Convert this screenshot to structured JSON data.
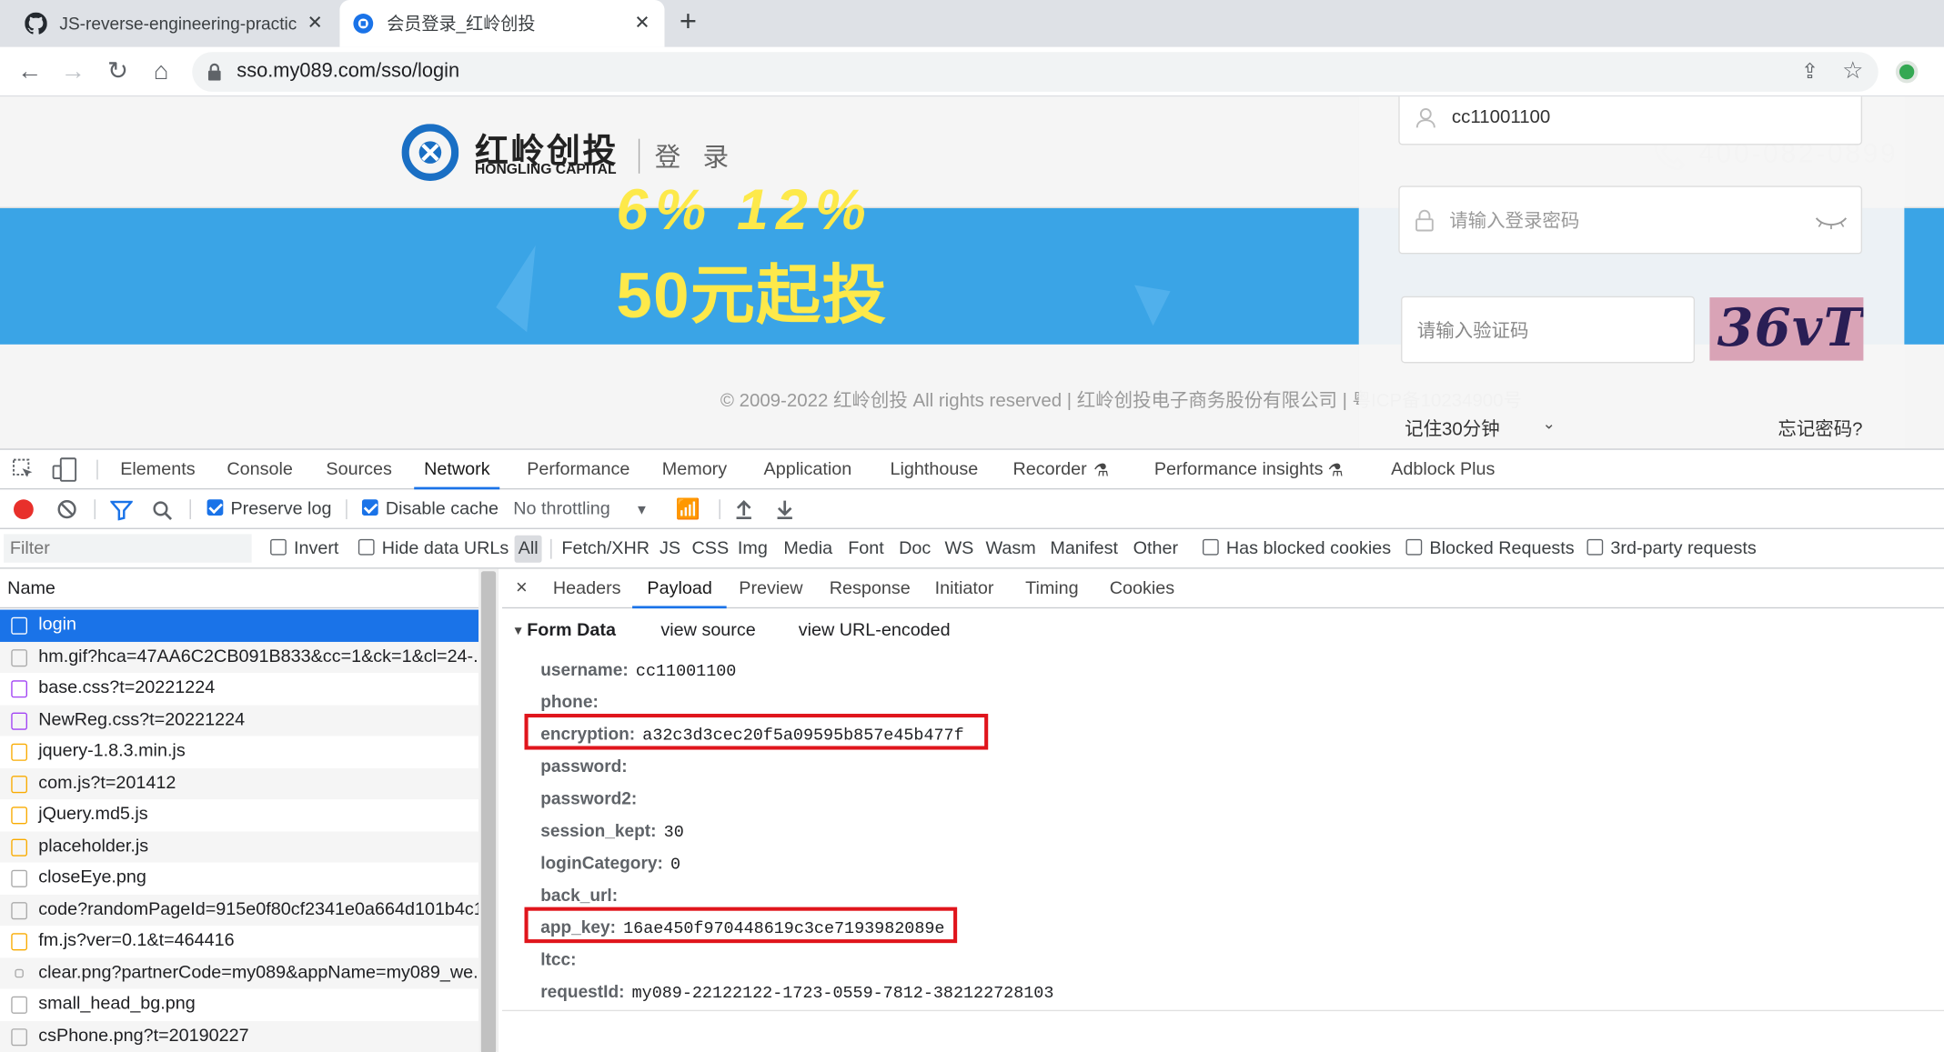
{
  "browser": {
    "tabs": [
      {
        "title": "JS-reverse-engineering-practic",
        "icon": "github-icon",
        "close": "✕"
      },
      {
        "title": "会员登录_红岭创投",
        "icon": "site-favicon-icon",
        "close": "✕"
      }
    ],
    "new_tab": "+",
    "url": "sso.my089.com/sso/login"
  },
  "page": {
    "logo_cn": "红岭创投",
    "logo_en": "HONGLING CAPITAL",
    "page_label": "登 录",
    "banner_top": "6% 12%",
    "banner_text": "50元起投",
    "hotline": "400-082-0899",
    "footer": "© 2009-2022 红岭创投 All rights reserved  |  红岭创投电子商务股份有限公司  |  粤ICP备10234900号",
    "login": {
      "username_value": "cc11001100",
      "password_placeholder": "请输入登录密码",
      "captcha_placeholder": "请输入验证码",
      "captcha_image_text": "36vT",
      "remember": "记住30分钟",
      "forgot": "忘记密码?"
    }
  },
  "devtools": {
    "tabs": [
      "Elements",
      "Console",
      "Sources",
      "Network",
      "Performance",
      "Memory",
      "Application",
      "Lighthouse",
      "Recorder",
      "Performance insights",
      "Adblock Plus"
    ],
    "active_tab": "Network",
    "toolbar": {
      "preserve_log": "Preserve log",
      "disable_cache": "Disable cache",
      "throttling": "No throttling"
    },
    "filter": {
      "placeholder": "Filter",
      "invert": "Invert",
      "hide_data_urls": "Hide data URLs",
      "types": [
        "All",
        "Fetch/XHR",
        "JS",
        "CSS",
        "Img",
        "Media",
        "Font",
        "Doc",
        "WS",
        "Wasm",
        "Manifest",
        "Other"
      ],
      "has_blocked_cookies": "Has blocked cookies",
      "blocked_requests": "Blocked Requests",
      "third_party": "3rd-party requests"
    },
    "list_header": "Name",
    "requests": [
      {
        "name": "login",
        "type": "doc"
      },
      {
        "name": "hm.gif?hca=47AA6C2CB091B833&cc=1&ck=1&cl=24-...",
        "type": "img"
      },
      {
        "name": "base.css?t=20221224",
        "type": "css"
      },
      {
        "name": "NewReg.css?t=20221224",
        "type": "css"
      },
      {
        "name": "jquery-1.8.3.min.js",
        "type": "js"
      },
      {
        "name": "com.js?t=201412",
        "type": "js"
      },
      {
        "name": "jQuery.md5.js",
        "type": "js"
      },
      {
        "name": "placeholder.js",
        "type": "js"
      },
      {
        "name": "closeEye.png",
        "type": "img"
      },
      {
        "name": "code?randomPageId=915e0f80cf2341e0a664d101b4c1",
        "type": "img"
      },
      {
        "name": "fm.js?ver=0.1&t=464416",
        "type": "js"
      },
      {
        "name": "clear.png?partnerCode=my089&appName=my089_we...",
        "type": "img"
      },
      {
        "name": "small_head_bg.png",
        "type": "img"
      },
      {
        "name": "csPhone.png?t=20190227",
        "type": "img"
      }
    ],
    "detail_tabs": [
      "Headers",
      "Payload",
      "Preview",
      "Response",
      "Initiator",
      "Timing",
      "Cookies"
    ],
    "active_detail_tab": "Payload",
    "form_data": {
      "title": "Form Data",
      "view_source": "view source",
      "view_url_encoded": "view URL-encoded",
      "fields": [
        {
          "key": "username:",
          "value": "cc11001100"
        },
        {
          "key": "phone:",
          "value": ""
        },
        {
          "key": "encryption:",
          "value": "a32c3d3cec20f5a09595b857e45b477f"
        },
        {
          "key": "password:",
          "value": ""
        },
        {
          "key": "password2:",
          "value": ""
        },
        {
          "key": "session_kept:",
          "value": "30"
        },
        {
          "key": "loginCategory:",
          "value": "0"
        },
        {
          "key": "back_url:",
          "value": ""
        },
        {
          "key": "app_key:",
          "value": "16ae450f970448619c3ce7193982089e"
        },
        {
          "key": "ltcc:",
          "value": ""
        },
        {
          "key": "requestId:",
          "value": "my089-22122122-1723-0559-7812-382122728103"
        }
      ]
    },
    "highlight_color": "#e0151c"
  }
}
